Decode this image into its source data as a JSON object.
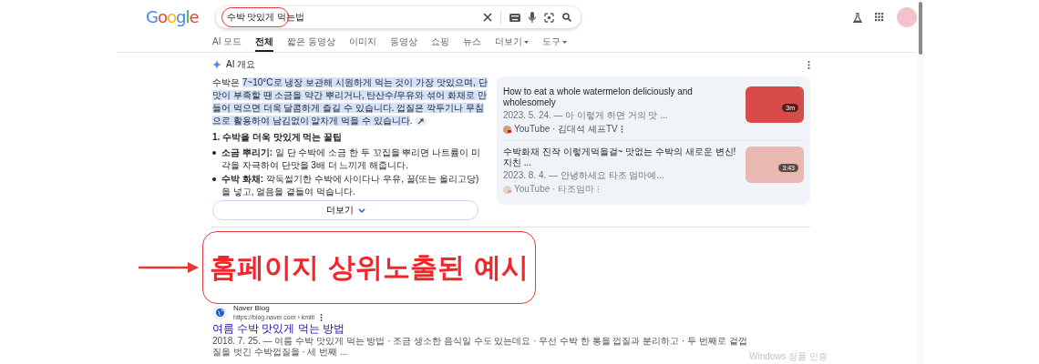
{
  "header": {
    "logo": "Google",
    "query": "수박 맛있게 먹는법"
  },
  "tabs": [
    {
      "label": "AI 모드",
      "selected": false,
      "dropdown": false
    },
    {
      "label": "전체",
      "selected": true,
      "dropdown": false
    },
    {
      "label": "짧은 동영상",
      "selected": false,
      "dropdown": false
    },
    {
      "label": "이미지",
      "selected": false,
      "dropdown": false
    },
    {
      "label": "동영상",
      "selected": false,
      "dropdown": false
    },
    {
      "label": "쇼핑",
      "selected": false,
      "dropdown": false
    },
    {
      "label": "뉴스",
      "selected": false,
      "dropdown": false
    },
    {
      "label": "더보기",
      "selected": false,
      "dropdown": true
    },
    {
      "label": "도구",
      "selected": false,
      "dropdown": true
    }
  ],
  "ai_overview": {
    "title": "AI 개요",
    "summary_start": "수박은 ",
    "summary_highlighted": "7~10°C로 냉장 보관해 시원하게 먹는 것이 가장 맛있으며, 단맛이 부족할 땐 소금을 약간 뿌리거나, 탄산수/우유와 섞어 화채로 만들어 먹으면 더욱 달콤하게 즐길 수 있습니다. 껍질은 깍두기나 무침으로 활용하여 남김없이 알차게 먹을 수 있습니다",
    "summary_end": ".",
    "heading": "1. 수박을 더욱 맛있게 먹는 꿀팁",
    "bullets": [
      "**소금 뿌리기:** 일 단 수박에 소금 한 두 꼬집을 뿌리면 나트륨이 미각을 자극하여 단맛을 3배 더 느끼게 해줍니다.",
      "**수박 화채:** 깍둑썰기한 수박에 사이다나 우유, 꿀(또는 올리고당)을 넣고, 얼음을 곁들여 먹습니다."
    ],
    "videos": [
      {
        "title": "How to eat a whole watermelon deliciously and wholesomely",
        "snippet": "2023. 5. 24. — 아 이렇게 하면 거의 맛 ...",
        "source": "YouTube · 김대석 셰프TV",
        "duration": "3m",
        "faded": false
      },
      {
        "title": "수박화채 진작 이렇게먹을걸~ 맛없는 수박의 새로운 변신! 지친 ...",
        "snippet": "2023. 8. 4. — 안녕하세요 타조 엄마예...",
        "source": "YouTube · 타조엄마",
        "duration": "3:43",
        "faded": true
      }
    ],
    "more_button": "더보기"
  },
  "result": {
    "site": "Naver Blog",
    "url": "https://blog.naver.com › kmiti",
    "title": "여름 수박 맛있게 먹는 방법",
    "snippet": "2018. 7. 25. — 여름 수박 맛있게 먹는 방법 · 조금 생소한 음식일 수도 있는데요 · 우선 수박 한 통을 껍질과 분리하고 · 두 번째로 겉껍질을 벗긴 수박껍질을 · 세 번째 ..."
  },
  "annotation": {
    "caption": "홈페이지 상위노출된 예시"
  },
  "os_notice": "Windows 정품 인증"
}
